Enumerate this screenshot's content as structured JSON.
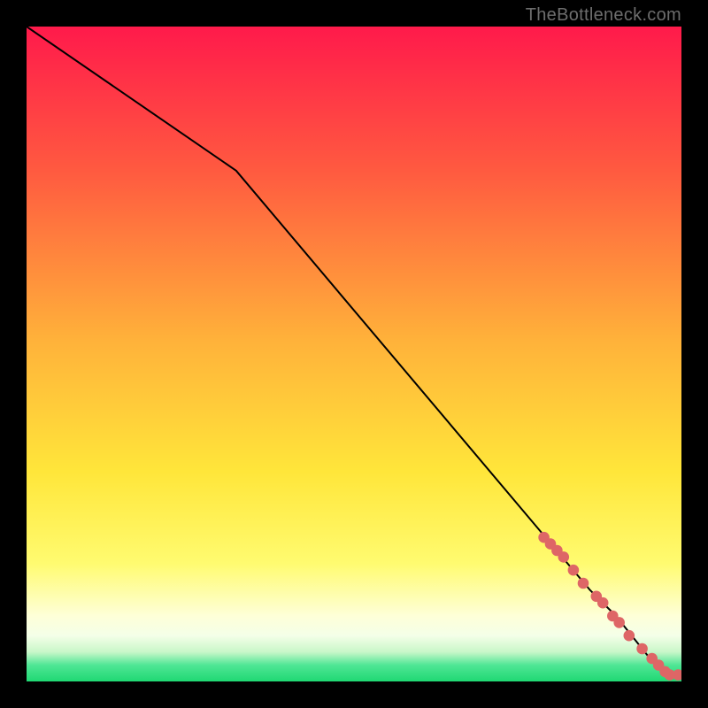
{
  "watermark": "TheBottleneck.com",
  "colors": {
    "bg_black": "#000000",
    "grad_top": "#ff1a4b",
    "grad_mid1": "#ff6a3c",
    "grad_mid2": "#ffd23a",
    "grad_mid3": "#fff856",
    "grad_pale": "#fdffe0",
    "grad_green": "#27e07c",
    "line": "#000000",
    "marker": "#de6666"
  },
  "chart_data": {
    "type": "line",
    "title": "",
    "xlabel": "",
    "ylabel": "",
    "xlim": [
      0,
      100
    ],
    "ylim": [
      0,
      100
    ],
    "grid": false,
    "legend": false,
    "line_series": {
      "name": "curve",
      "x": [
        0,
        32,
        86,
        90,
        94,
        96,
        98,
        100
      ],
      "y": [
        100,
        78,
        14,
        10,
        5,
        2.5,
        1,
        1
      ]
    },
    "markers": {
      "name": "highlight-points",
      "x": [
        79,
        80,
        81,
        82,
        83.5,
        85,
        87,
        88,
        89.5,
        90.5,
        92,
        94,
        95.5,
        96.5,
        97.5,
        98.2,
        99.5
      ],
      "y": [
        22,
        21,
        20,
        19,
        17,
        15,
        13,
        12,
        10,
        9,
        7,
        5,
        3.5,
        2.5,
        1.5,
        1,
        1
      ]
    }
  }
}
